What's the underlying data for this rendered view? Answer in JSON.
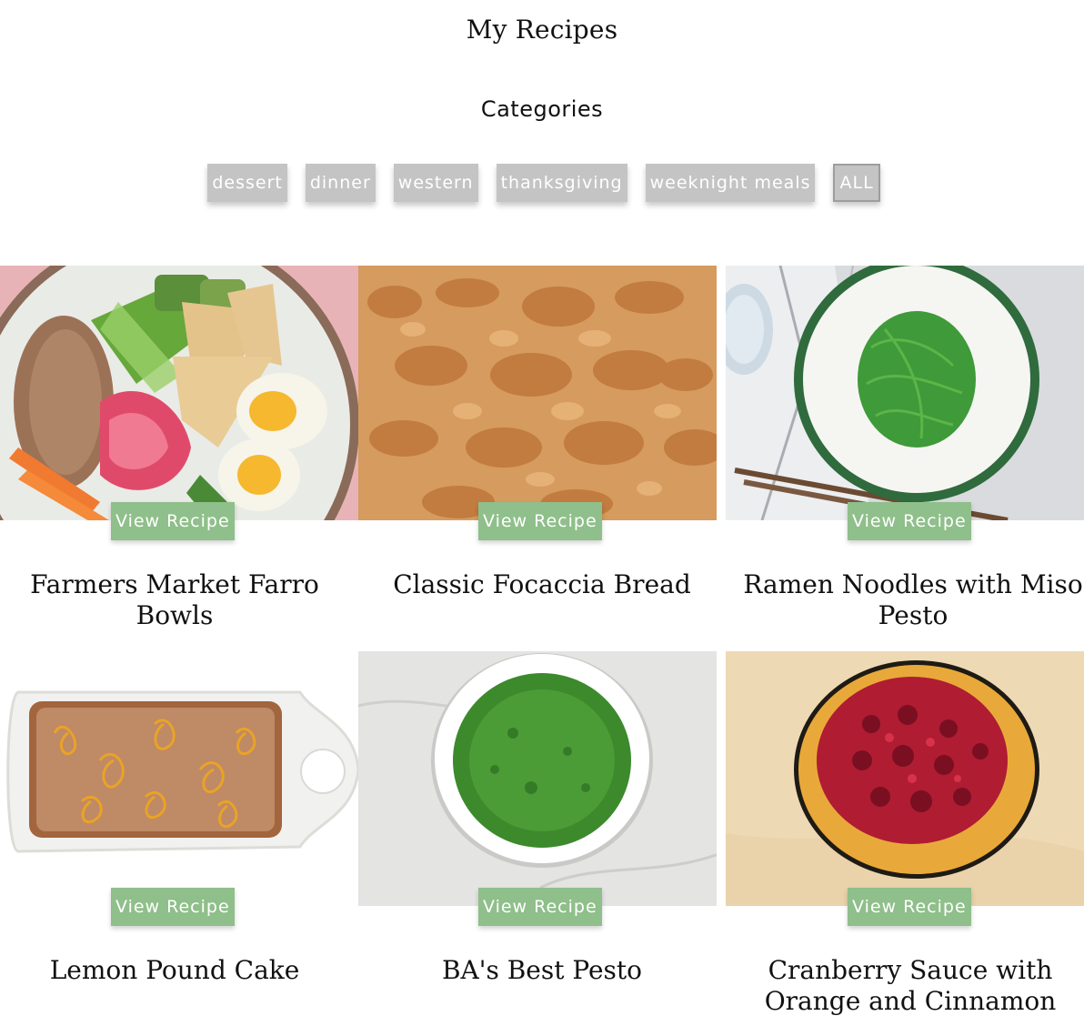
{
  "header": {
    "title": "My Recipes",
    "categories_heading": "Categories"
  },
  "categories": [
    {
      "label": "dessert"
    },
    {
      "label": "dinner"
    },
    {
      "label": "western"
    },
    {
      "label": "thanksgiving"
    },
    {
      "label": "weeknight meals"
    },
    {
      "label": "ALL",
      "active": true
    }
  ],
  "recipes": [
    {
      "title": "Farmers Market Farro Bowls",
      "button": "View Recipe",
      "image": "farro-bowl-image"
    },
    {
      "title": "Classic Focaccia Bread",
      "button": "View Recipe",
      "image": "focaccia-image"
    },
    {
      "title": "Ramen Noodles with Miso Pesto",
      "button": "View Recipe",
      "image": "ramen-image"
    },
    {
      "title": "Lemon Pound Cake",
      "button": "View Recipe",
      "image": "pound-cake-image"
    },
    {
      "title": "BA's Best Pesto",
      "button": "View Recipe",
      "image": "pesto-image"
    },
    {
      "title": "Cranberry Sauce with Orange and Cinnamon",
      "button": "View Recipe",
      "image": "cranberry-sauce-image"
    }
  ],
  "colors": {
    "chip_bg": "#c4c4c4",
    "button_bg": "#8fbf8a",
    "text": "#111111"
  }
}
